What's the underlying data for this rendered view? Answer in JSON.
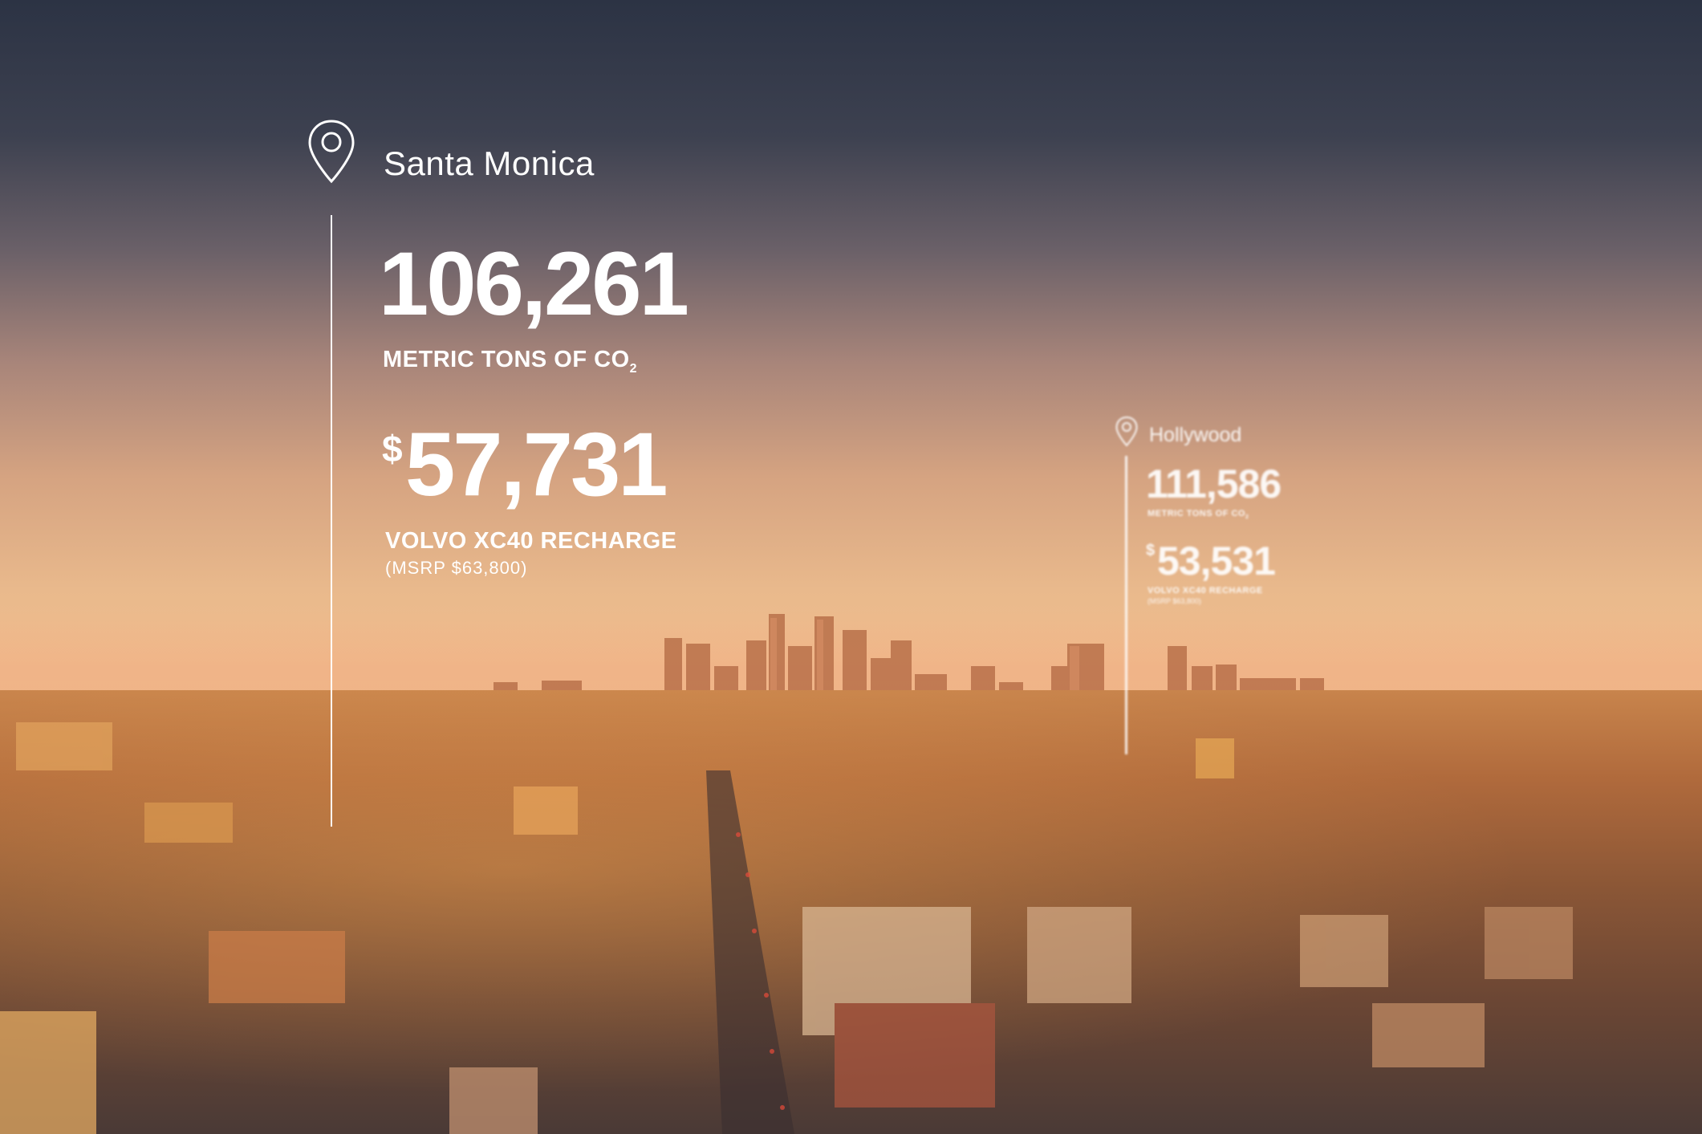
{
  "primary_callout": {
    "location": "Santa Monica",
    "co2_value": "106,261",
    "co2_label": "METRIC TONS OF CO",
    "co2_subscript": "2",
    "currency_symbol": "$",
    "price_value": "57,731",
    "vehicle_label": "VOLVO XC40 RECHARGE",
    "msrp_label": "(MSRP $63,800)"
  },
  "secondary_callout": {
    "location": "Hollywood",
    "co2_value": "111,586",
    "co2_label": "METRIC TONS OF CO",
    "co2_subscript": "2",
    "currency_symbol": "$",
    "price_value": "53,531",
    "vehicle_label": "VOLVO XC40 RECHARGE",
    "msrp_label": "(MSRP $63,800)"
  },
  "icons": [
    "map-pin-icon"
  ],
  "colors": {
    "text": "#ffffff",
    "sky_top": "#2c3344",
    "sky_glow": "#f2c08f"
  }
}
